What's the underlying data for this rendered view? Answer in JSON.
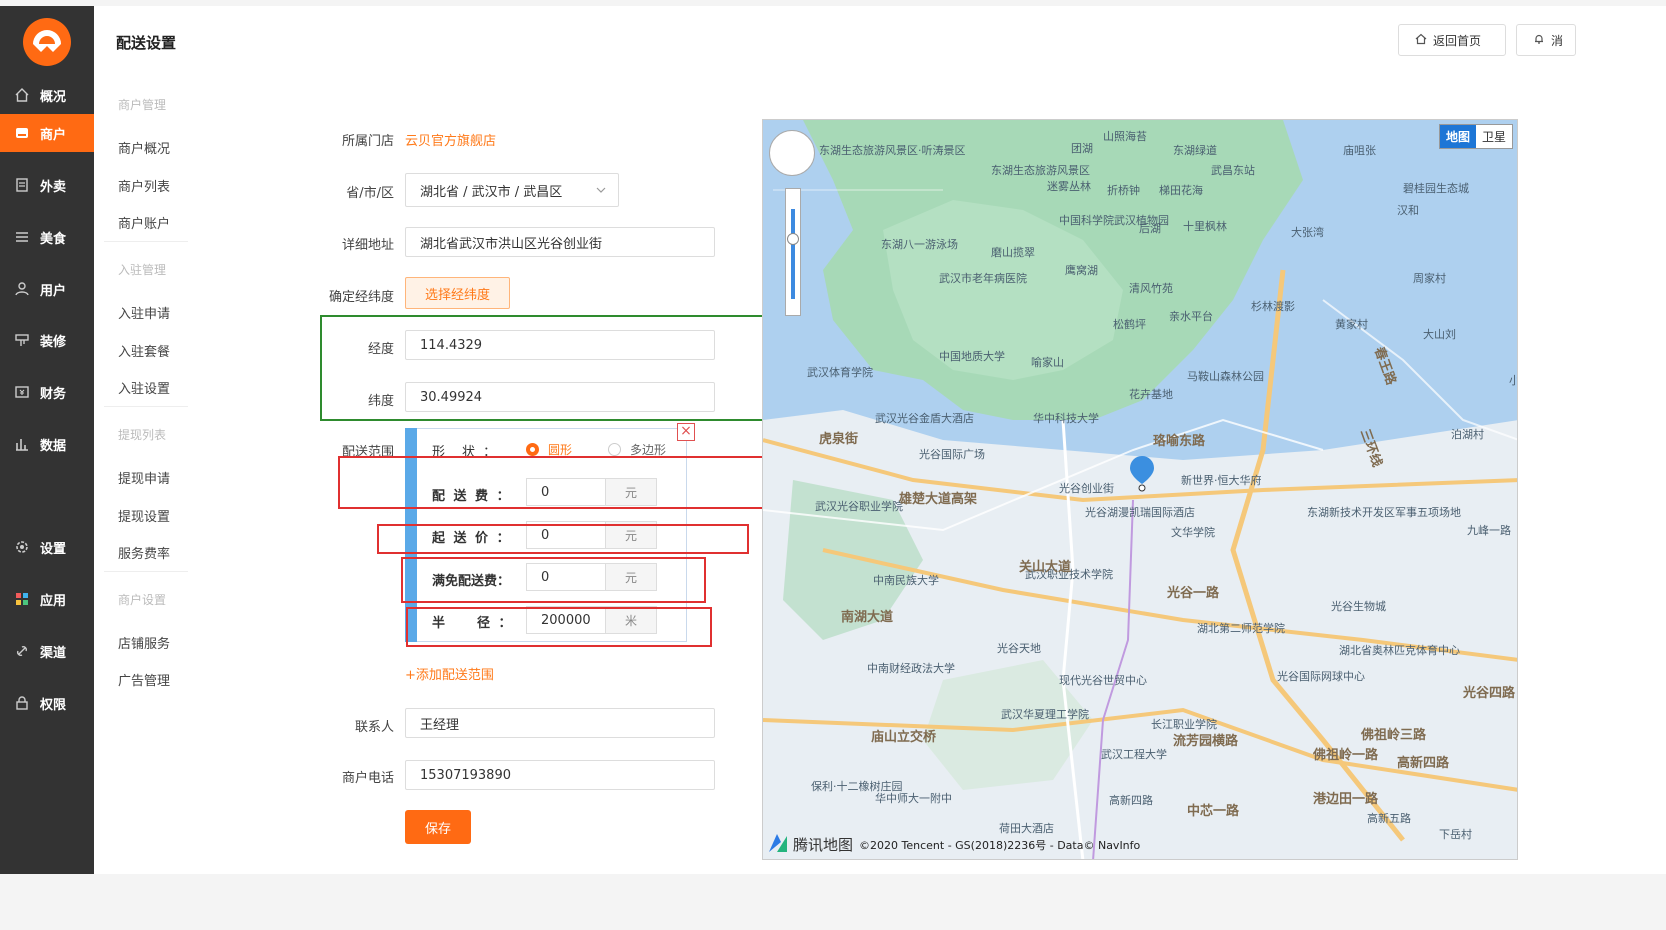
{
  "brand": {
    "accent": "#ff6a13",
    "nav_bg": "#333333"
  },
  "nav": [
    {
      "label": "概况",
      "icon": "home-icon"
    },
    {
      "label": "商户",
      "icon": "store-icon",
      "active": true
    },
    {
      "label": "外卖",
      "icon": "document-icon"
    },
    {
      "label": "美食",
      "icon": "menu-icon"
    },
    {
      "label": "用户",
      "icon": "user-icon"
    },
    {
      "label": "装修",
      "icon": "brush-icon"
    },
    {
      "label": "财务",
      "icon": "finance-icon"
    },
    {
      "label": "数据",
      "icon": "bar-chart-icon"
    },
    {
      "label": "设置",
      "icon": "gear-icon"
    },
    {
      "label": "应用",
      "icon": "apps-icon"
    },
    {
      "label": "渠道",
      "icon": "link-icon"
    },
    {
      "label": "权限",
      "icon": "lock-icon"
    }
  ],
  "header": {
    "title": "配送设置",
    "home_btn": "返回首页",
    "msg_btn": "消"
  },
  "subnav": {
    "groups": [
      "商户管理",
      "入驻管理",
      "提现列表",
      "商户设置"
    ],
    "items": [
      "商户概况",
      "商户列表",
      "商户账户",
      "入驻申请",
      "入驻套餐",
      "入驻设置",
      "提现申请",
      "提现设置",
      "服务费率",
      "店铺服务",
      "广告管理"
    ]
  },
  "form": {
    "store_label": "所属门店",
    "store_value": "云贝官方旗舰店",
    "region_label": "省/市/区",
    "region_value": "湖北省 / 武汉市 / 武昌区",
    "address_label": "详细地址",
    "address_value": "湖北省武汉市洪山区光谷创业街",
    "latlng_label": "确定经纬度",
    "latlng_btn": "选择经纬度",
    "lng_label": "经度",
    "lng_value": "114.4329",
    "lat_label": "纬度",
    "lat_value": "30.49924",
    "range_label": "配送范围",
    "shape_label": "形　状 ：",
    "shape_circle": "圆形",
    "shape_polygon": "多边形",
    "fee_label": "配 送 费 ：",
    "fee_value": "0",
    "fee_unit": "元",
    "min_label": "起 送 价 ：",
    "min_value": "0",
    "min_unit": "元",
    "free_label": "满免配送费：",
    "free_value": "0",
    "free_unit": "元",
    "radius_label": "半　　径 ：",
    "radius_value": "200000",
    "radius_unit": "米",
    "add_range": "+添加配送范围",
    "contact_label": "联系人",
    "contact_value": "王经理",
    "phone_label": "商户电话",
    "phone_value": "15307193890",
    "save_btn": "保存"
  },
  "map": {
    "type_map": "地图",
    "type_sat": "卫星",
    "brand": "腾讯地图",
    "copyright": "©2020 Tencent - GS(2018)2236号 - Data© NavInfo",
    "labels": [
      "山照海苔",
      "东湖绿道",
      "庙咀张",
      "东湖生态旅游风景区·听涛景区",
      "团湖",
      "东湖生态旅游风景区",
      "迷雾丛林",
      "折桥钟",
      "梯田花海",
      "武昌东站",
      "碧桂园生态城",
      "中国科学院武汉植物园",
      "后湖",
      "十里枫林",
      "汉和",
      "大张湾",
      "东湖八一游泳场",
      "磨山揽翠",
      "武汉市老年病医院",
      "鹰窝湖",
      "清风竹苑",
      "杉林渡影",
      "周家村",
      "松鹤坪",
      "亲水平台",
      "黄家村",
      "大山刘",
      "中国地质大学",
      "喻家山",
      "马鞍山森林公园",
      "武汉体育学院",
      "华中科技大学",
      "花卉基地",
      "武汉光谷金盾大酒店",
      "光谷国际广场",
      "新世界·恒大华府",
      "武汉光谷职业学院",
      "光谷创业街",
      "光谷湖漫凯瑞国际酒店",
      "文华学院",
      "东湖新技术开发区军事五项场地",
      "九峰一路",
      "中南民族大学",
      "武汉职业技术学院",
      "湖北第二师范学院",
      "光谷生物城",
      "光谷天地",
      "湖北省奥林匹克体育中心",
      "中南财经政法大学",
      "现代光谷世贸中心",
      "光谷国际网球中心",
      "武汉华夏理工学院",
      "长江职业学院",
      "武汉工程大学",
      "保利·十二橡树庄园",
      "华中师大一附中",
      "荷田大酒店",
      "高新四路",
      "高新五路",
      "下岳村",
      "泊湖村",
      "小王村"
    ],
    "roads": [
      "雄楚大道高架",
      "南湖大道",
      "三环线",
      "珞喻东路",
      "庙山立交桥",
      "关山大道",
      "光谷一路",
      "流芳园横路",
      "佛祖岭一路",
      "佛祖岭三路",
      "高新四路",
      "港边田一路",
      "中芯一路",
      "光谷四路",
      "虎泉街",
      "春王路"
    ]
  }
}
